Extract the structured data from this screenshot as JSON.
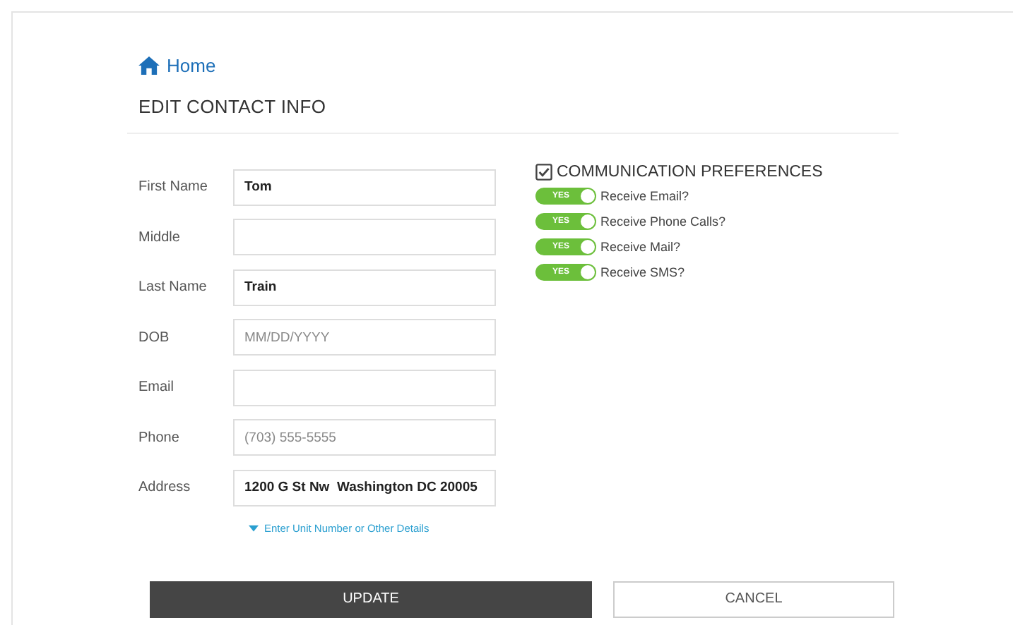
{
  "breadcrumb": {
    "label": "Home"
  },
  "title": "EDIT CONTACT INFO",
  "fields": [
    {
      "label": "First Name",
      "value": "Tom"
    },
    {
      "label": "Middle"
    },
    {
      "label": "Last Name",
      "value": "Train"
    },
    {
      "label": "DOB",
      "placeholder": "MM/DD/YYYY"
    },
    {
      "label": "Email"
    },
    {
      "label": "Phone",
      "placeholder": "(703) 555-5555"
    },
    {
      "label": "Address",
      "value": "1200 G St Nw  Washington DC 20005"
    }
  ],
  "details_link": "Enter Unit Number or Other Details",
  "preferences": {
    "title": "COMMUNICATION PREFERENCES",
    "checked": true,
    "toggles": [
      {
        "switch_label": "YES",
        "label": "Receive Email?",
        "on": true
      },
      {
        "switch_label": "YES",
        "label": "Receive Phone Calls?",
        "on": true
      },
      {
        "switch_label": "YES",
        "label": "Receive Mail?",
        "on": true
      },
      {
        "switch_label": "YES",
        "label": "Receive SMS?",
        "on": true
      }
    ]
  },
  "buttons": [
    {
      "kind": "primary",
      "label": "UPDATE"
    },
    {
      "kind": "secondary",
      "label": "CANCEL"
    }
  ]
}
